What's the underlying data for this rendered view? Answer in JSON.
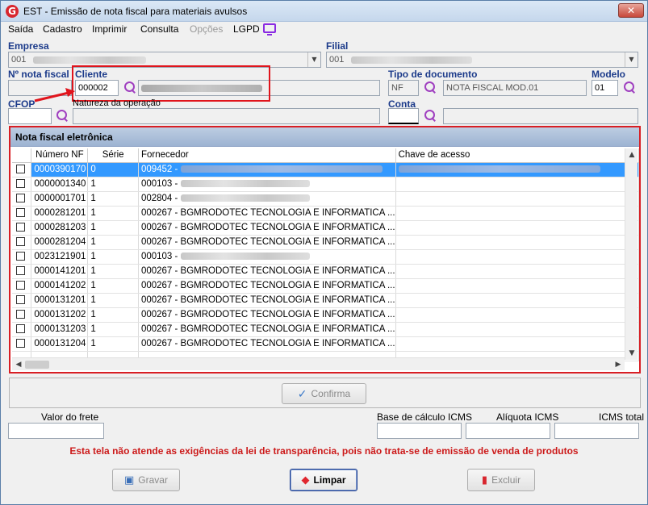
{
  "window": {
    "title": "EST - Emissão de nota fiscal para materiais avulsos",
    "icon_letter": "G",
    "close_label": "✕"
  },
  "menu": {
    "items": [
      {
        "label": "Saída"
      },
      {
        "label": "Cadastro"
      },
      {
        "label": "Imprimir"
      },
      {
        "label": "Consulta"
      },
      {
        "label": "Opções",
        "disabled": true
      },
      {
        "label": "LGPD"
      }
    ]
  },
  "form": {
    "empresa_label": "Empresa",
    "empresa_value": "001",
    "filial_label": "Filial",
    "filial_value": "001",
    "nota_fiscal_label": "Nº nota fiscal",
    "cliente_label": "Cliente",
    "cliente_code": "000002",
    "tipo_documento_label": "Tipo de documento",
    "tipo_documento_code": "NF",
    "tipo_documento_desc": "NOTA FISCAL MOD.01",
    "modelo_label": "Modelo",
    "modelo_value": "01",
    "cfop_label": "CFOP",
    "natureza_label": "Natureza da operação",
    "conta_label": "Conta"
  },
  "grid": {
    "title": "Nota fiscal eletrônica",
    "columns": [
      "Número NF",
      "Série",
      "Fornecedor",
      "Chave de acesso"
    ],
    "rows": [
      {
        "numero": "0000390170",
        "serie": "0",
        "fornecedor": "009452 -",
        "selected": true
      },
      {
        "numero": "0000001340",
        "serie": "1",
        "fornecedor": "000103 -"
      },
      {
        "numero": "0000001701",
        "serie": "1",
        "fornecedor": "002804 -"
      },
      {
        "numero": "0000281201",
        "serie": "1",
        "fornecedor": "000267 - BGMRODOTEC TECNOLOGIA E INFORMATICA ..."
      },
      {
        "numero": "0000281203",
        "serie": "1",
        "fornecedor": "000267 - BGMRODOTEC TECNOLOGIA E INFORMATICA ..."
      },
      {
        "numero": "0000281204",
        "serie": "1",
        "fornecedor": "000267 - BGMRODOTEC TECNOLOGIA E INFORMATICA ..."
      },
      {
        "numero": "0023121901",
        "serie": "1",
        "fornecedor": "000103 -"
      },
      {
        "numero": "0000141201",
        "serie": "1",
        "fornecedor": "000267 - BGMRODOTEC TECNOLOGIA E INFORMATICA ..."
      },
      {
        "numero": "0000141202",
        "serie": "1",
        "fornecedor": "000267 - BGMRODOTEC TECNOLOGIA E INFORMATICA ..."
      },
      {
        "numero": "0000131201",
        "serie": "1",
        "fornecedor": "000267 - BGMRODOTEC TECNOLOGIA E INFORMATICA ..."
      },
      {
        "numero": "0000131202",
        "serie": "1",
        "fornecedor": "000267 - BGMRODOTEC TECNOLOGIA E INFORMATICA ..."
      },
      {
        "numero": "0000131203",
        "serie": "1",
        "fornecedor": "000267 - BGMRODOTEC TECNOLOGIA E INFORMATICA ..."
      },
      {
        "numero": "0000131204",
        "serie": "1",
        "fornecedor": "000267 - BGMRODOTEC TECNOLOGIA E INFORMATICA ..."
      }
    ]
  },
  "buttons": {
    "confirma": "Confirma",
    "gravar": "Gravar",
    "limpar": "Limpar",
    "excluir": "Excluir"
  },
  "totals": {
    "valor_frete_label": "Valor do frete",
    "base_icms_label": "Base de cálculo ICMS",
    "aliquota_icms_label": "Alíquota ICMS",
    "icms_total_label": "ICMS total"
  },
  "warning_text": "Esta tela não atende as exigências da lei de transparência, pois não trata-se de emissão de venda de produtos",
  "colors": {
    "highlight": "#e0141c",
    "selection": "#3399ff",
    "warning": "#cc1a1a",
    "label_blue": "#1b3a8a"
  }
}
